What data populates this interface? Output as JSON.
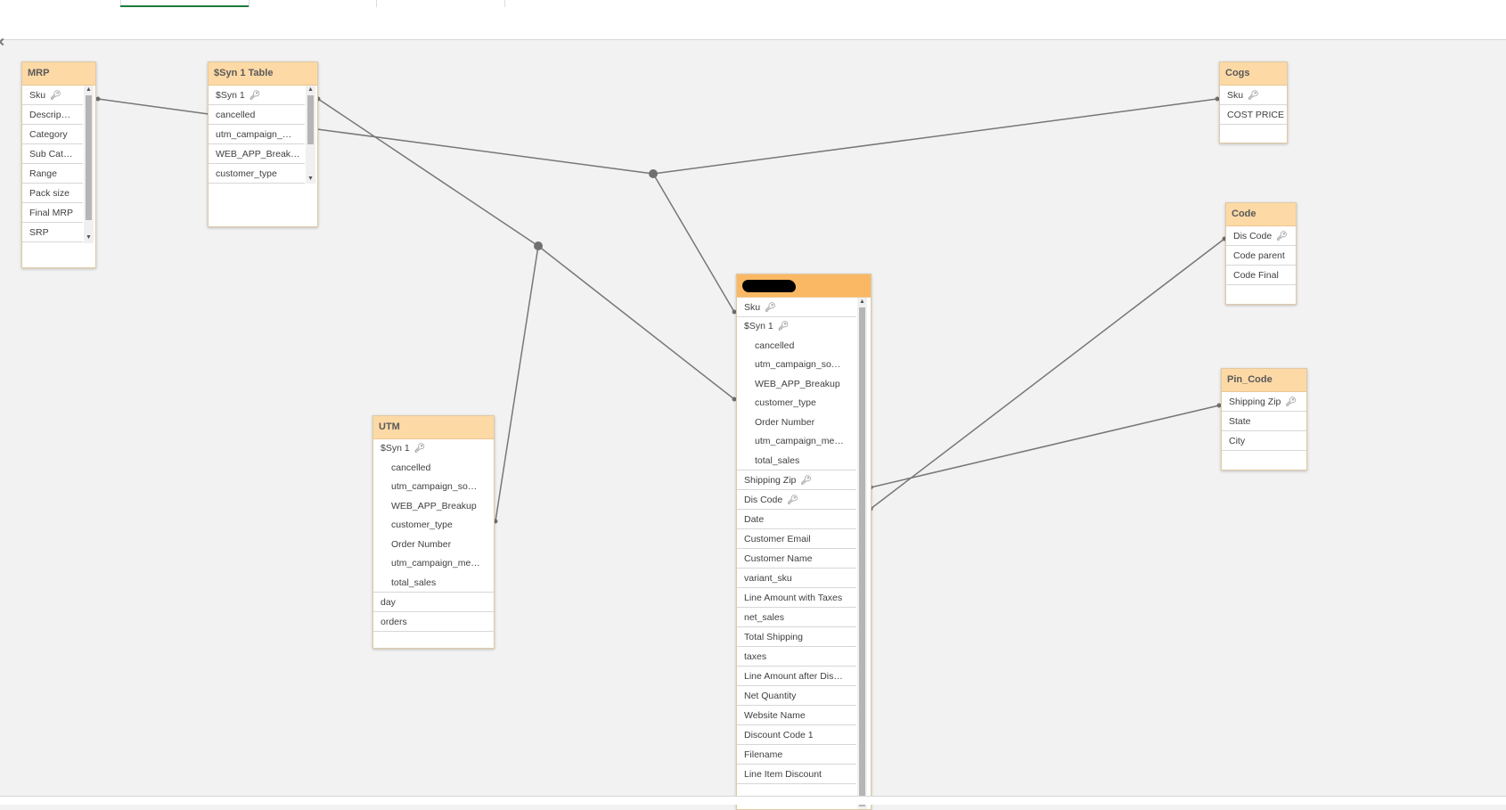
{
  "tables": {
    "mrp": {
      "title": "MRP",
      "fields": [
        "Sku",
        "Descrip…",
        "Category",
        "Sub Cat…",
        "Range",
        "Pack size",
        "Final MRP",
        "SRP"
      ],
      "key_fields": [
        "Sku"
      ]
    },
    "syn1": {
      "title": "$Syn 1 Table",
      "fields": [
        "$Syn 1",
        "cancelled",
        "utm_campaign_…",
        "WEB_APP_Break…",
        "customer_type"
      ],
      "key_fields": [
        "$Syn 1"
      ]
    },
    "cogs": {
      "title": "Cogs",
      "fields": [
        "Sku",
        "COST PRICE"
      ],
      "key_fields": [
        "Sku"
      ]
    },
    "code": {
      "title": "Code",
      "fields": [
        "Dis Code",
        "Code parent",
        "Code Final"
      ],
      "key_fields": [
        "Dis Code"
      ]
    },
    "pincode": {
      "title": "Pin_Code",
      "fields": [
        "Shipping Zip",
        "State",
        "City"
      ],
      "key_fields": [
        "Shipping Zip"
      ]
    },
    "utm": {
      "title": "UTM",
      "synkey": "$Syn 1",
      "subfields": [
        "cancelled",
        "utm_campaign_so…",
        "WEB_APP_Breakup",
        "customer_type",
        "Order Number",
        "utm_campaign_me…",
        "total_sales"
      ],
      "fields": [
        "day",
        "orders"
      ]
    },
    "main": {
      "title": "",
      "title_redacted": true,
      "sku": "Sku",
      "synkey": "$Syn 1",
      "subfields": [
        "cancelled",
        "utm_campaign_so…",
        "WEB_APP_Breakup",
        "customer_type",
        "Order Number",
        "utm_campaign_me…",
        "total_sales"
      ],
      "fields": [
        "Shipping Zip",
        "Dis Code",
        "Date",
        "Customer Email",
        "Customer Name",
        "variant_sku",
        "Line Amount with Taxes",
        "net_sales",
        "Total Shipping",
        "taxes",
        "Line Amount after Dis…",
        "Net Quantity",
        "Website Name",
        "Discount Code 1",
        "Filename",
        "Line Item Discount"
      ],
      "key_fields": [
        "Shipping Zip",
        "Dis Code"
      ]
    }
  },
  "icons": {
    "key": "key-icon",
    "scroll_up": "arrow-up-icon",
    "scroll_down": "arrow-down-icon"
  },
  "colors": {
    "header": "#fdd9a6",
    "header_selected": "#fbb864",
    "link": "#777777",
    "canvas": "#f2f2f2"
  }
}
